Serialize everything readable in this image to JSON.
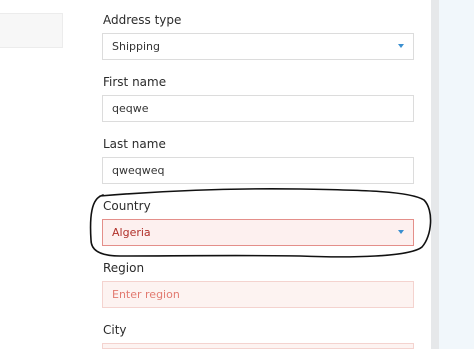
{
  "form": {
    "address_type": {
      "label": "Address type",
      "value": "Shipping"
    },
    "first_name": {
      "label": "First name",
      "value": "qeqwe"
    },
    "last_name": {
      "label": "Last name",
      "value": "qweqweq"
    },
    "country": {
      "label": "Country",
      "value": "Algeria"
    },
    "region": {
      "label": "Region",
      "placeholder": "Enter region"
    },
    "city": {
      "label": "City"
    }
  },
  "colors": {
    "error_border": "#e48f8a",
    "error_background": "#fdf0ef",
    "accent": "#3a8fd0",
    "annotation_stroke": "#111111"
  },
  "icons": {
    "dropdown": "chevron-down-icon"
  }
}
